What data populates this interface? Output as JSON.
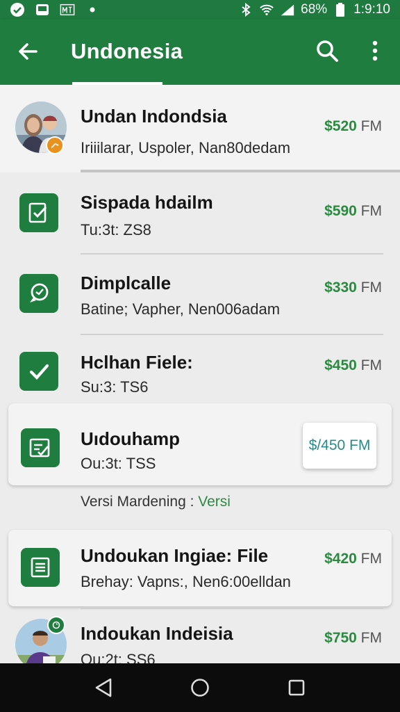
{
  "status_bar": {
    "battery": "68%",
    "time": "1:9:10",
    "left_icons": [
      "check-circle-icon",
      "screen-icon",
      "sim-icon",
      "dot-icon"
    ],
    "right_icons": [
      "bluetooth-icon",
      "wifi-icon",
      "signal-icon",
      "battery-icon"
    ]
  },
  "app_bar": {
    "title": "Undonesia",
    "icons": [
      "back-arrow-icon",
      "search-icon",
      "more-vert-icon"
    ]
  },
  "items": [
    {
      "name": "Undan Indondsia",
      "sub": "Iriiilarar, Uspoler, Nan80dedam",
      "price_value": "$520",
      "price_unit": " FM",
      "icon": "avatar-couple"
    },
    {
      "name": "Sispada hdailm",
      "sub": "Tu:3t: ZS8",
      "price_value": "$590",
      "price_unit": " FM",
      "icon": "edit-check-icon"
    },
    {
      "name": "Dimplcalle",
      "sub": "Batine; Vapher, Nen006adam",
      "price_value": "$330",
      "price_unit": " FM",
      "icon": "chat-icon"
    },
    {
      "name": "Hclhan Fiele:",
      "sub": "Su:3: TS6",
      "price_value": "$450",
      "price_unit": " FM",
      "icon": "check-icon"
    },
    {
      "name": "Uıdouhamp",
      "sub": "Ou:3t: TSS",
      "price_value": "$/450 FM",
      "icon": "doc-edit-icon"
    },
    {
      "name": "Undoukan Ingiae: File",
      "sub": "Brehay: Vapns:, Nen6:00elldan",
      "price_value": "$420",
      "price_unit": " FM",
      "icon": "list-doc-icon"
    },
    {
      "name": "Indoukan Indeisia",
      "sub": "Ou:2t: SS6",
      "price_value": "$750",
      "price_unit": " FM",
      "icon": "avatar-man"
    }
  ],
  "version": {
    "label": "Versi Mardening : ",
    "value": "Versi"
  },
  "nav": {
    "icons": [
      "back-triangle-icon",
      "home-circle-icon",
      "recents-square-icon"
    ]
  },
  "colors": {
    "primary": "#1f7d3f",
    "price_green": "#2a8a3f",
    "background": "#ececec"
  }
}
